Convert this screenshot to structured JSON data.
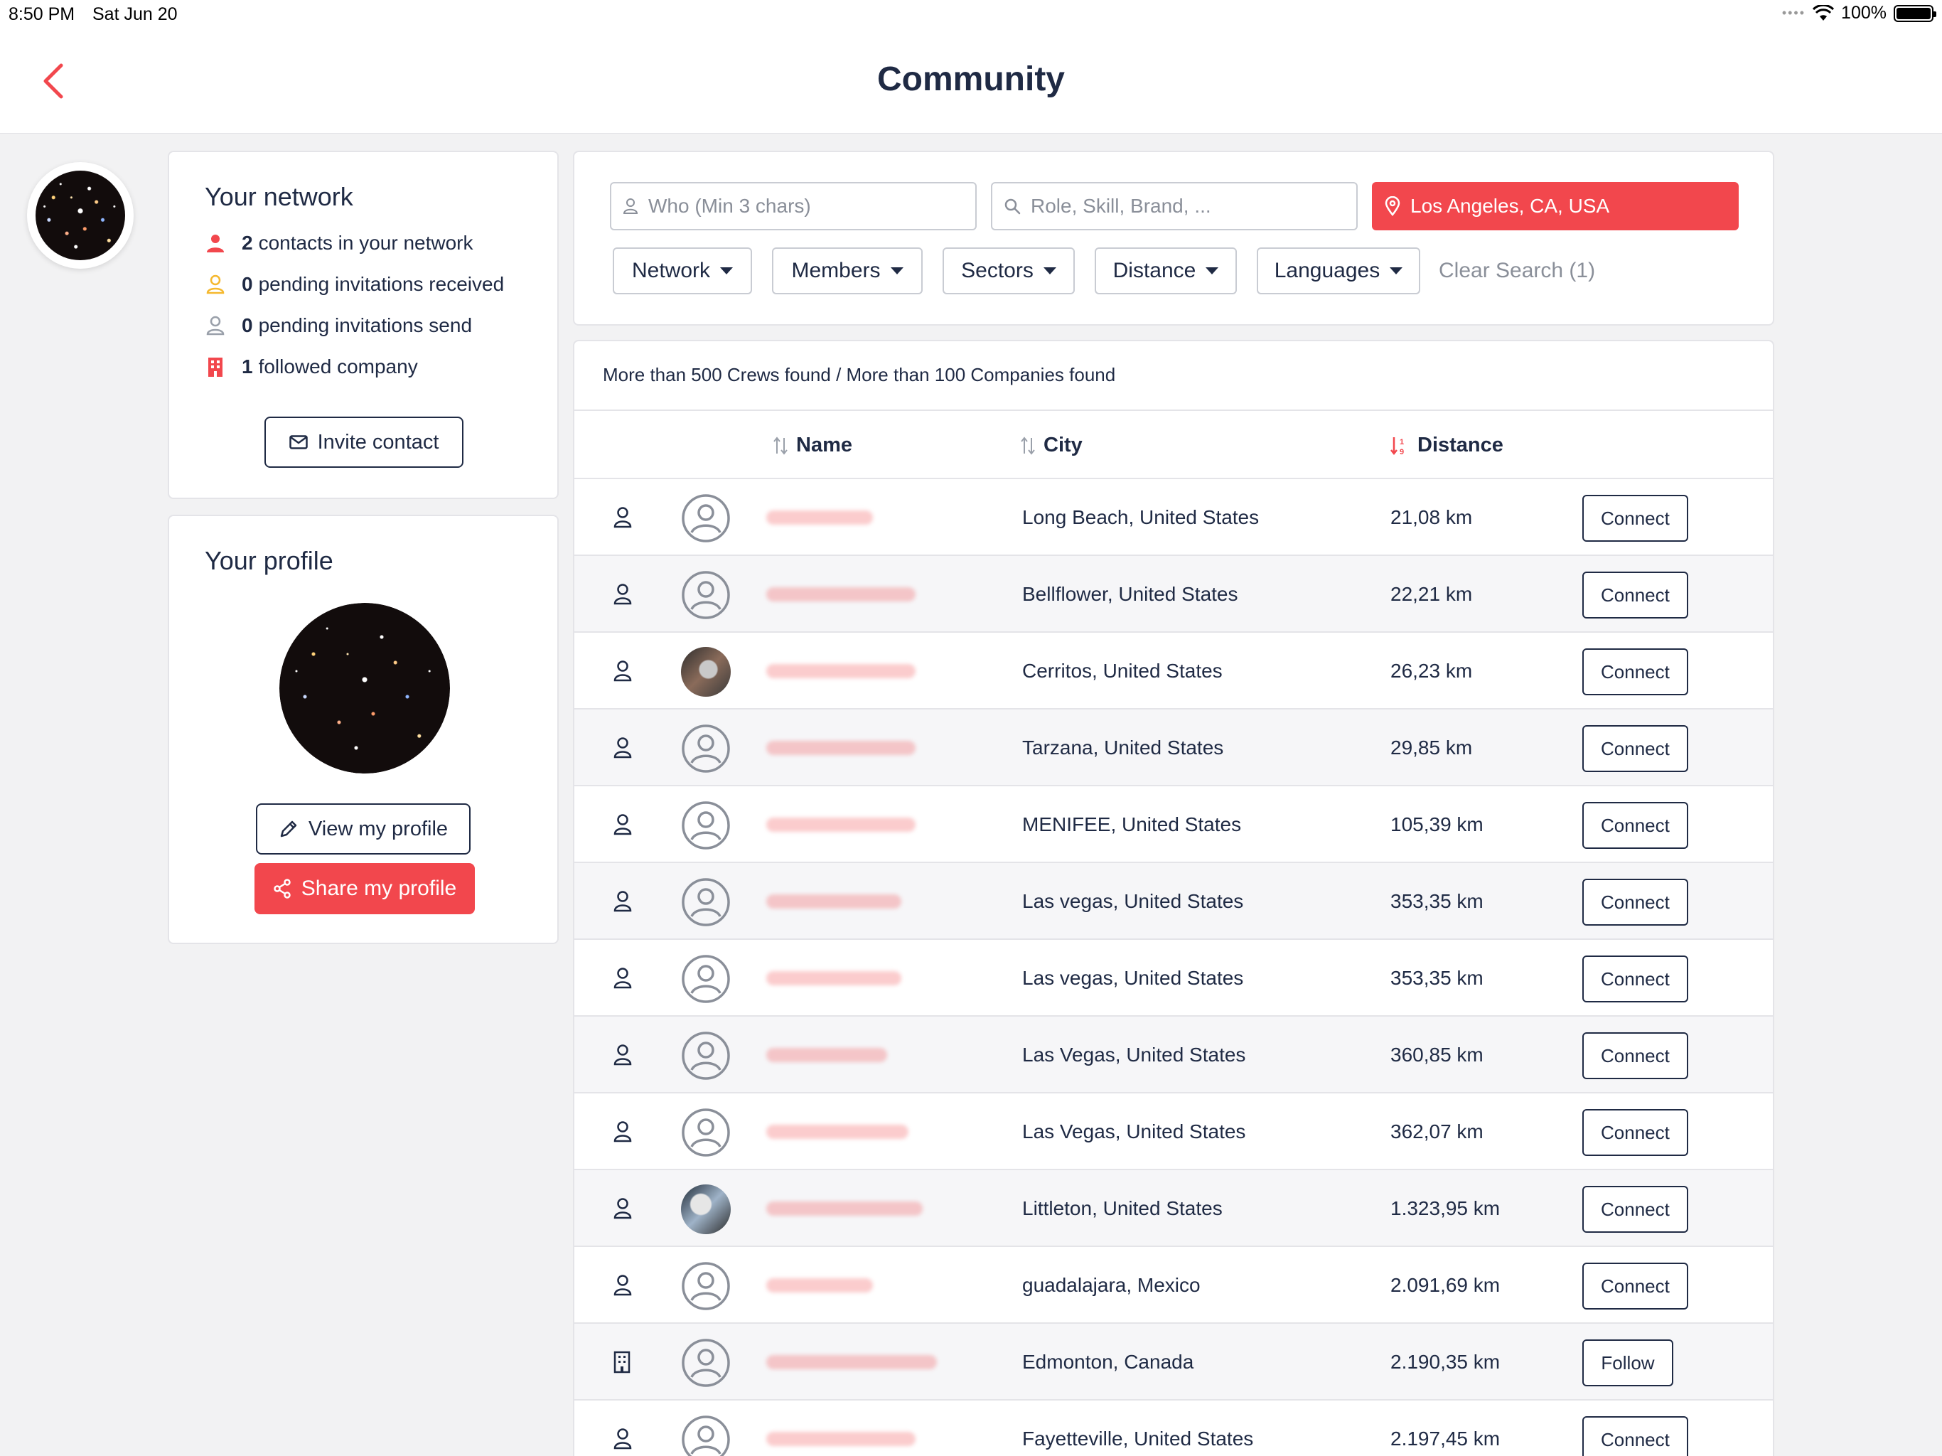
{
  "status_bar": {
    "time": "8:50 PM",
    "date": "Sat Jun 20",
    "battery": "100%"
  },
  "nav": {
    "title": "Community"
  },
  "colors": {
    "accent": "#f2474d",
    "text": "#1f2a44",
    "muted": "#8a8f99",
    "pending_received": "#f5b82e"
  },
  "network": {
    "title": "Your network",
    "items": [
      {
        "icon": "person-filled-icon",
        "count": "2",
        "label": "contacts in your network"
      },
      {
        "icon": "person-outline-yellow-icon",
        "count": "0",
        "label": "pending invitations received"
      },
      {
        "icon": "person-outline-gray-icon",
        "count": "0",
        "label": "pending invitations send"
      },
      {
        "icon": "building-icon",
        "count": "1",
        "label": "followed company"
      }
    ],
    "invite_label": "Invite contact"
  },
  "profile": {
    "title": "Your profile",
    "view_label": "View my profile",
    "share_label": "Share my profile"
  },
  "search": {
    "who_placeholder": "Who (Min 3 chars)",
    "role_placeholder": "Role, Skill, Brand, ...",
    "location_value": "Los Angeles, CA, USA",
    "filters": [
      "Network",
      "Members",
      "Sectors",
      "Distance",
      "Languages"
    ],
    "clear_label": "Clear Search (1)"
  },
  "results": {
    "summary": "More than 500 Crews found / More than 100 Companies found",
    "columns": {
      "name": "Name",
      "city": "City",
      "distance": "Distance"
    },
    "rows": [
      {
        "type": "person",
        "avatar": "placeholder",
        "city": "Long Beach, United States",
        "distance": "21,08 km",
        "action": "Connect"
      },
      {
        "type": "person",
        "avatar": "placeholder",
        "city": "Bellflower, United States",
        "distance": "22,21 km",
        "action": "Connect"
      },
      {
        "type": "person",
        "avatar": "photo",
        "city": "Cerritos, United States",
        "distance": "26,23 km",
        "action": "Connect"
      },
      {
        "type": "person",
        "avatar": "placeholder",
        "city": "Tarzana, United States",
        "distance": "29,85 km",
        "action": "Connect"
      },
      {
        "type": "person",
        "avatar": "placeholder",
        "city": "MENIFEE, United States",
        "distance": "105,39 km",
        "action": "Connect"
      },
      {
        "type": "person",
        "avatar": "placeholder",
        "city": "Las vegas, United States",
        "distance": "353,35 km",
        "action": "Connect"
      },
      {
        "type": "person",
        "avatar": "placeholder",
        "city": "Las vegas, United States",
        "distance": "353,35 km",
        "action": "Connect"
      },
      {
        "type": "person",
        "avatar": "placeholder",
        "city": "Las Vegas, United States",
        "distance": "360,85 km",
        "action": "Connect"
      },
      {
        "type": "person",
        "avatar": "placeholder",
        "city": "Las Vegas, United States",
        "distance": "362,07 km",
        "action": "Connect"
      },
      {
        "type": "person",
        "avatar": "photo",
        "city": "Littleton, United States",
        "distance": "1.323,95 km",
        "action": "Connect"
      },
      {
        "type": "person",
        "avatar": "placeholder",
        "city": "guadalajara, Mexico",
        "distance": "2.091,69 km",
        "action": "Connect"
      },
      {
        "type": "company",
        "avatar": "placeholder",
        "city": "Edmonton, Canada",
        "distance": "2.190,35 km",
        "action": "Follow"
      },
      {
        "type": "person",
        "avatar": "placeholder",
        "city": "Fayetteville, United States",
        "distance": "2.197,45 km",
        "action": "Connect"
      }
    ]
  }
}
